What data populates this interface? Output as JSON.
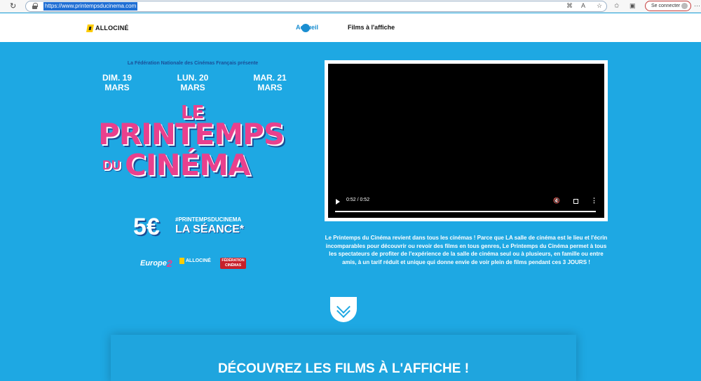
{
  "browser": {
    "url": "https://www.printempsducinema.com",
    "signin_label": "Se connecter"
  },
  "header": {
    "logo_text": "ALLOCINÉ",
    "nav": [
      "Accueil",
      "Films à l'affiche"
    ]
  },
  "promo": {
    "federation": "La Fédération Nationale des Cinémas Français présente",
    "dates": [
      {
        "day": "DIM. 19",
        "month": "MARS"
      },
      {
        "day": "LUN. 20",
        "month": "MARS"
      },
      {
        "day": "MAR. 21",
        "month": "MARS"
      }
    ],
    "title": {
      "le": "LE",
      "printemps": "PRINTEMPS",
      "du": "DU",
      "cinema": "CINÉMA"
    },
    "price": "5€",
    "hashtag": "#PRINTEMPSDUCINEMA",
    "seance": "LA SÉANCE*",
    "partners": {
      "europe": "Europe",
      "europe_num": "2",
      "allocine": "ALLOCINÉ",
      "fnc_top": "FÉDÉRATION",
      "fnc_bottom": "CINÉMAS"
    }
  },
  "video": {
    "time": "0:52 / 0:52",
    "progress": 1.0
  },
  "description": "Le Printemps du Cinéma revient dans tous les cinémas ! Parce que LA salle de cinéma est le lieu et l'écrin incomparables pour découvrir ou revoir des films en tous genres, Le Printemps du Cinéma permet à tous les spectateurs de profiter de l'expérience de la salle de cinéma seul ou à plusieurs, en famille ou entre amis, à un tarif réduit et unique qui donne envie de voir plein de films pendant ces 3 JOURS !",
  "films_section": {
    "title": "DÉCOUVREZ LES FILMS À L'AFFICHE !"
  },
  "colors": {
    "background": "#1ea8e3",
    "pink": "#e9408d",
    "navy": "#1a4e97",
    "accent": "#1a8ed1"
  }
}
